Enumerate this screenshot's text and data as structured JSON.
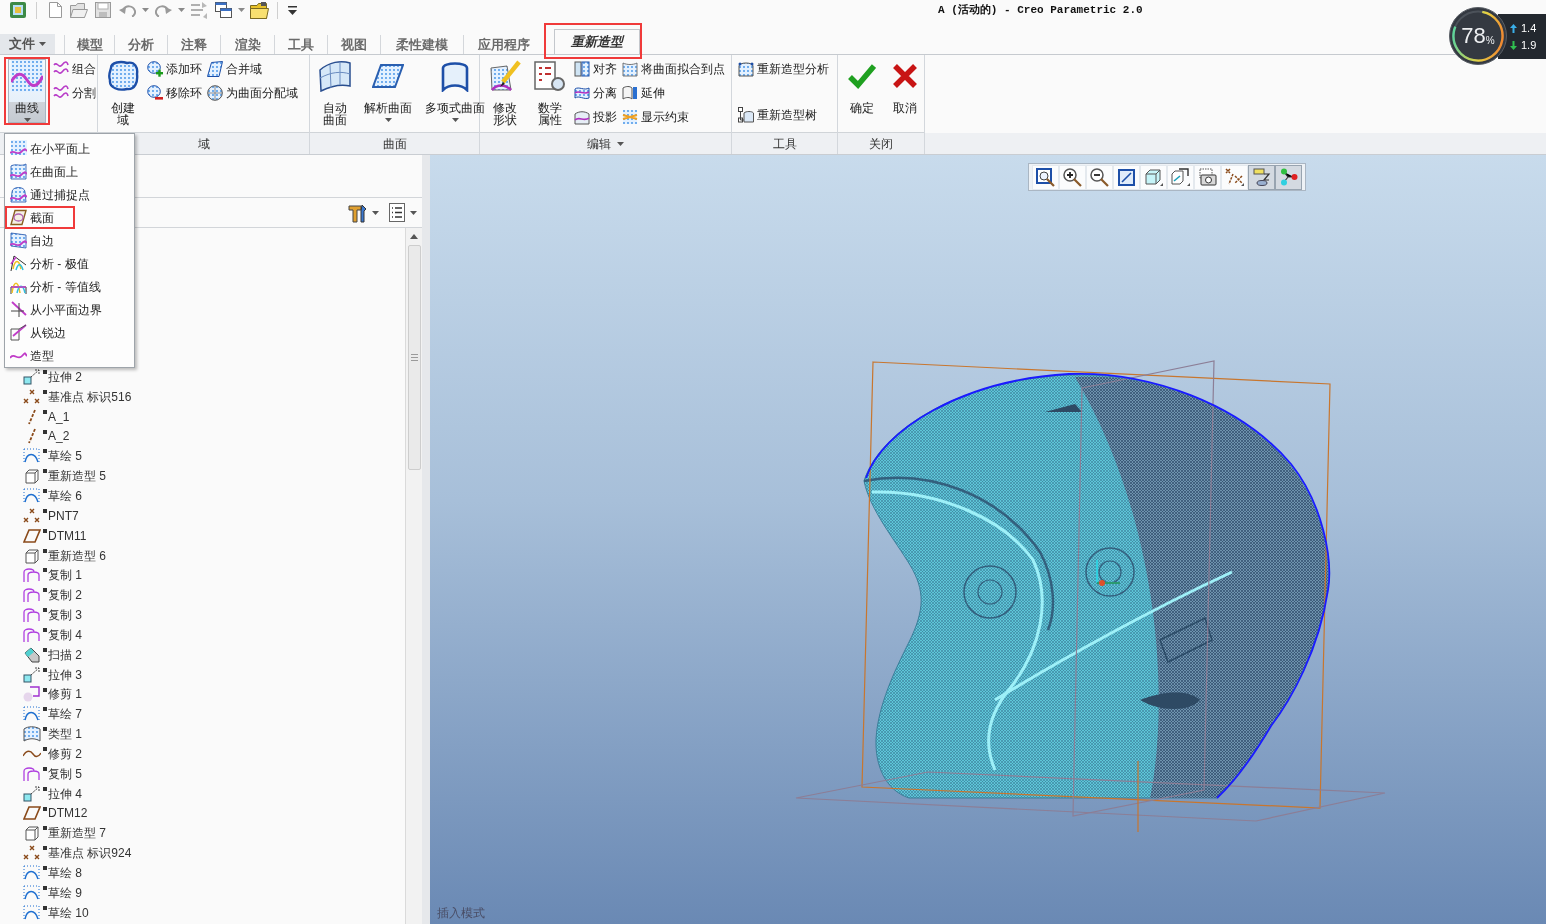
{
  "quick_access": [
    {
      "kind": "app"
    },
    {
      "kind": "separator"
    },
    {
      "kind": "new"
    },
    {
      "kind": "open"
    },
    {
      "kind": "save"
    },
    {
      "kind": "undo"
    },
    {
      "kind": "caret"
    },
    {
      "kind": "redo"
    },
    {
      "kind": "caret"
    },
    {
      "kind": "regenerate"
    },
    {
      "kind": "windows"
    },
    {
      "kind": "caret"
    },
    {
      "kind": "folder"
    },
    {
      "kind": "separator"
    },
    {
      "kind": "customize"
    }
  ],
  "title": "A (活动的) - Creo Parametric 2.0",
  "tabs": [
    {
      "kind": "file_menu",
      "label": "文件",
      "selected": false,
      "highlighted": false
    },
    {
      "kind": "tab",
      "label": "模型",
      "selected": false,
      "highlighted": false
    },
    {
      "kind": "tab",
      "label": "分析",
      "selected": false,
      "highlighted": false
    },
    {
      "kind": "tab",
      "label": "注释",
      "selected": false,
      "highlighted": false
    },
    {
      "kind": "tab",
      "label": "渲染",
      "selected": false,
      "highlighted": false
    },
    {
      "kind": "tab",
      "label": "工具",
      "selected": false,
      "highlighted": false
    },
    {
      "kind": "tab",
      "label": "视图",
      "selected": false,
      "highlighted": false
    },
    {
      "kind": "tab",
      "label": "柔性建模",
      "selected": false,
      "highlighted": false
    },
    {
      "kind": "tab",
      "label": "应用程序",
      "selected": false,
      "highlighted": false
    },
    {
      "kind": "tab",
      "label": "重新造型",
      "selected": true,
      "highlighted": true
    }
  ],
  "ribbon": {
    "groups": [
      {
        "controls": [
          {
            "kind": "large",
            "label": "曲线",
            "has_menu": true,
            "expanded": true,
            "highlighted": true
          },
          {
            "kind": "column",
            "items": [
              {
                "label": "组合"
              },
              {
                "label": "分割"
              }
            ]
          }
        ]
      },
      {
        "label": "域",
        "has_menu": false,
        "controls": [
          {
            "kind": "large_stacked",
            "label": "创建域",
            "has_menu": false,
            "expanded": false,
            "highlighted": false
          },
          {
            "kind": "column",
            "items": [
              {
                "label": "添加环"
              },
              {
                "label": "移除环"
              }
            ]
          },
          {
            "kind": "column",
            "items": [
              {
                "label": "合并域"
              },
              {
                "label": "为曲面分配域"
              }
            ]
          }
        ]
      },
      {
        "label": "曲面",
        "has_menu": false,
        "controls": [
          {
            "kind": "large_stacked",
            "label": "自动曲面",
            "has_menu": false,
            "expanded": false,
            "highlighted": false
          },
          {
            "kind": "large",
            "label": "解析曲面",
            "has_menu": true,
            "expanded": false,
            "highlighted": false
          },
          {
            "kind": "large",
            "label": "多项式曲面",
            "has_menu": true,
            "expanded": false,
            "highlighted": false
          }
        ]
      },
      {
        "label": "编辑",
        "has_menu": true,
        "controls": [
          {
            "kind": "large_stacked",
            "label": "修改形状",
            "has_menu": false,
            "expanded": false,
            "highlighted": false
          },
          {
            "kind": "large_stacked",
            "label": "数学属性",
            "has_menu": false,
            "expanded": false,
            "highlighted": false
          },
          {
            "kind": "column",
            "items": [
              {
                "label": "对齐"
              },
              {
                "label": "分离"
              },
              {
                "label": "投影"
              }
            ]
          },
          {
            "kind": "column",
            "items": [
              {
                "label": "将曲面拟合到点"
              },
              {
                "label": "延伸"
              },
              {
                "label": "显示约束"
              }
            ]
          }
        ]
      },
      {
        "label": "工具",
        "has_menu": false,
        "controls": [
          {
            "kind": "spread_column",
            "items": [
              {
                "label": "重新造型分析"
              },
              {
                "label": "重新造型树"
              }
            ]
          }
        ]
      },
      {
        "label": "关闭",
        "has_menu": false,
        "controls": [
          {
            "kind": "large",
            "label": "确定",
            "has_menu": false,
            "expanded": false,
            "highlighted": false
          },
          {
            "kind": "large",
            "label": "取消",
            "has_menu": false,
            "expanded": false,
            "highlighted": false
          }
        ]
      }
    ]
  },
  "curve_menu": {
    "items": [
      {
        "label": "在小平面上",
        "highlighted": false
      },
      {
        "label": "在曲面上",
        "highlighted": false
      },
      {
        "label": "通过捕捉点",
        "highlighted": false
      },
      {
        "label": "截面",
        "highlighted": true
      },
      {
        "label": "自边",
        "highlighted": false
      },
      {
        "label": "分析 - 极值",
        "highlighted": false
      },
      {
        "label": "分析 - 等值线",
        "highlighted": false
      },
      {
        "label": "从小平面边界",
        "highlighted": false
      },
      {
        "label": "从锐边",
        "highlighted": false
      },
      {
        "label": "造型",
        "highlighted": false
      }
    ]
  },
  "model_tree": {
    "items": [
      {
        "kind": "extrude",
        "label": "拉伸 2"
      },
      {
        "kind": "datum_point",
        "label": "基准点 标识516"
      },
      {
        "kind": "axis",
        "label": "A_1"
      },
      {
        "kind": "axis",
        "label": "A_2"
      },
      {
        "kind": "sketch",
        "label": "草绘 5"
      },
      {
        "kind": "restyle",
        "label": "重新造型 5"
      },
      {
        "kind": "sketch",
        "label": "草绘 6"
      },
      {
        "kind": "datum_point",
        "label": "PNT7"
      },
      {
        "kind": "datum_plane",
        "label": "DTM11"
      },
      {
        "kind": "restyle",
        "label": "重新造型 6"
      },
      {
        "kind": "copy",
        "label": "复制 1"
      },
      {
        "kind": "copy",
        "label": "复制 2"
      },
      {
        "kind": "copy",
        "label": "复制 3"
      },
      {
        "kind": "copy",
        "label": "复制 4"
      },
      {
        "kind": "sweep",
        "label": "扫描 2"
      },
      {
        "kind": "extrude",
        "label": "拉伸 3"
      },
      {
        "kind": "trim",
        "label": "修剪 1"
      },
      {
        "kind": "sketch",
        "label": "草绘 7"
      },
      {
        "kind": "type",
        "label": "类型 1"
      },
      {
        "kind": "curve_trim",
        "label": "修剪 2"
      },
      {
        "kind": "copy",
        "label": "复制 5"
      },
      {
        "kind": "extrude",
        "label": "拉伸 4"
      },
      {
        "kind": "datum_plane",
        "label": "DTM12"
      },
      {
        "kind": "restyle",
        "label": "重新造型 7"
      },
      {
        "kind": "datum_point",
        "label": "基准点 标识924"
      },
      {
        "kind": "sketch",
        "label": "草绘 8"
      },
      {
        "kind": "sketch",
        "label": "草绘 9"
      },
      {
        "kind": "sketch",
        "label": "草绘 10"
      }
    ]
  },
  "view_toolbar": [
    {
      "kind": "refit",
      "pressed": false
    },
    {
      "kind": "zoom_in",
      "pressed": false
    },
    {
      "kind": "zoom_out",
      "pressed": false
    },
    {
      "kind": "repaint",
      "pressed": false
    },
    {
      "kind": "display_style",
      "pressed": false
    },
    {
      "kind": "orientation",
      "pressed": false
    },
    {
      "kind": "view_manager",
      "pressed": false
    },
    {
      "kind": "datum_display",
      "pressed": false
    },
    {
      "kind": "annotation_display",
      "pressed": true
    },
    {
      "kind": "spin_center",
      "pressed": true
    }
  ],
  "status_text": "插入模式",
  "usage_gauge": {
    "value": "78",
    "unit": "%",
    "upload": "1.4",
    "download": "1.9"
  }
}
